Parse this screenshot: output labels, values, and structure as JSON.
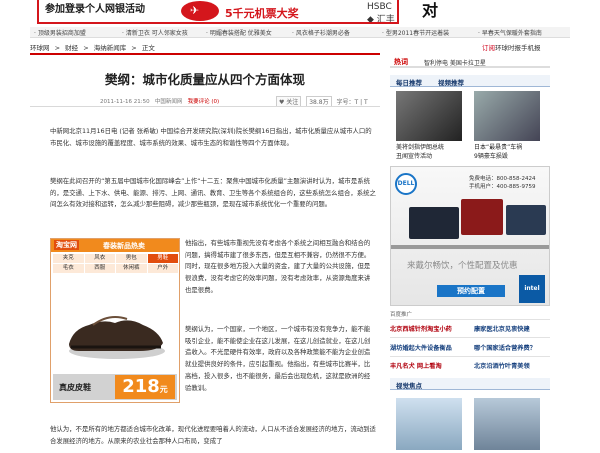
{
  "banner": {
    "left_text": "参加登录个人网银活动",
    "plane_glyph": "✈",
    "prize_text": "5千元机票大奖",
    "hsbc_text": "HSBC ◆ 汇丰",
    "right_text": "对"
  },
  "linkbar": [
    "· 顶级男装招商加盟",
    "· 清新卫衣 可人邻家女孩",
    "· 明媚春装搭配 优雅美女",
    "· 风衣格子衫潮男必备",
    "· 型男2011春节开运着装",
    "· 早春天气保暖外套指南"
  ],
  "breadcrumb": [
    "环球网",
    ">",
    "财经",
    ">",
    "海纳新闻库",
    ">",
    "正文"
  ],
  "breadcrumb_right": {
    "red": "订阅",
    "rest": "环球时报手机报"
  },
  "article": {
    "title": "樊纲：城市化质量应从四个方面体现",
    "date": "2011-11-16 21:50",
    "source": "中国新闻网",
    "comment": "我要评论 (0)",
    "like": "关注",
    "count": "38.8万",
    "font_tools": "字号：T | T",
    "paragraphs": [
      "中新网北京11月16日电 (记者 张希敏) 中国综合开发研究院(深圳)院长樊纲16日指出，城市化质量应从城市人口的市民化、城市设施的覆盖程度、城市系统的效果、城市生态的和谐性等四个方面体现。",
      "樊纲在此间召开的“第五届中国城市化国际峰会”上作“十二五：聚焦中国城市化质量”主题演讲时认为，城市是系统的，是交通、上下水、供电、能源、排污、上网、通讯、教育、卫生等各个系统组合的，这些系统怎么组合，系统之间怎么有效对接和运转，怎么减少那些阻碍，减少那些瓶颈，是现在城市系统优化一个重要的问题。",
      "他指出，有些城市重视先没有考虑各个系统之间相互融合和结合的问题，搞得城市建了很多东西，但是互相不兼容，仍然很不方便。同时，现在很多地方投入大量的资金，建了大量的公共设施，但是很浪费，没有考虑它的效率问题，没有考虑效率，从资源角度来讲也是很费。",
      "樊纲认为，一个国家，一个地区，一个城市有没有竞争力，能不能吸引企业，能不能使企业在这儿发展，在这儿创造就业，在这儿创造收入。不光是硬件有效率，政府以及各种政策能不能为企业创造就业提供良好的条件，应引起重视。他指出，有些城市比赛半，比高档，投入很多，也不能很务，最后会出现危机，这就是欧洲的经验教训。",
      "他认为，不是所有的地方都适合城市化改革，现代化进程要咱着人的流动，人口从不适合发展经济的地方，流动到适合发展经济的地方。从原来的农业社会那种人口布局，变成了"
    ]
  },
  "shoe_ad": {
    "brand": "淘宝网",
    "subtitle": "春装新品热卖",
    "categories": [
      [
        "夹克",
        "风衣",
        "男包",
        "男鞋"
      ],
      [
        "毛衣",
        "西服",
        "休闲裤",
        "户外"
      ]
    ],
    "price_label": "真皮皮鞋",
    "price": "218",
    "price_unit": "元"
  },
  "sidebar": {
    "hot_title": "热词",
    "hot_links": "智利停电  美国卡拉卫星",
    "tabs": [
      "每日推荐",
      "视频推荐"
    ],
    "thumb_captions": [
      [
        "美将剑指伊朗总统",
        "丑闻宣传活动"
      ],
      [
        "日本“最悬贵”车祸",
        "9辆豪车损毁"
      ]
    ],
    "dell": {
      "logo": "DELL",
      "phone_line1": "免费电话：800-858-2424",
      "phone_line2": "手机用户：400-885-9759",
      "slogan": "来戴尔畅饮，个性配置及优惠",
      "cta": "预约配置",
      "intel": "intel"
    },
    "ad_label": "百度推广",
    "news": [
      [
        "北京西城针剂淘宝小药",
        "康家医北京见衷快建"
      ],
      [
        "湖坊婚起大件设备衡品",
        "哪个国家适合营养费？"
      ],
      [
        "丰凡名犬 网上看淘",
        "北京沿酒竹叶青美领"
      ]
    ],
    "video_title": "视觉焦点"
  }
}
